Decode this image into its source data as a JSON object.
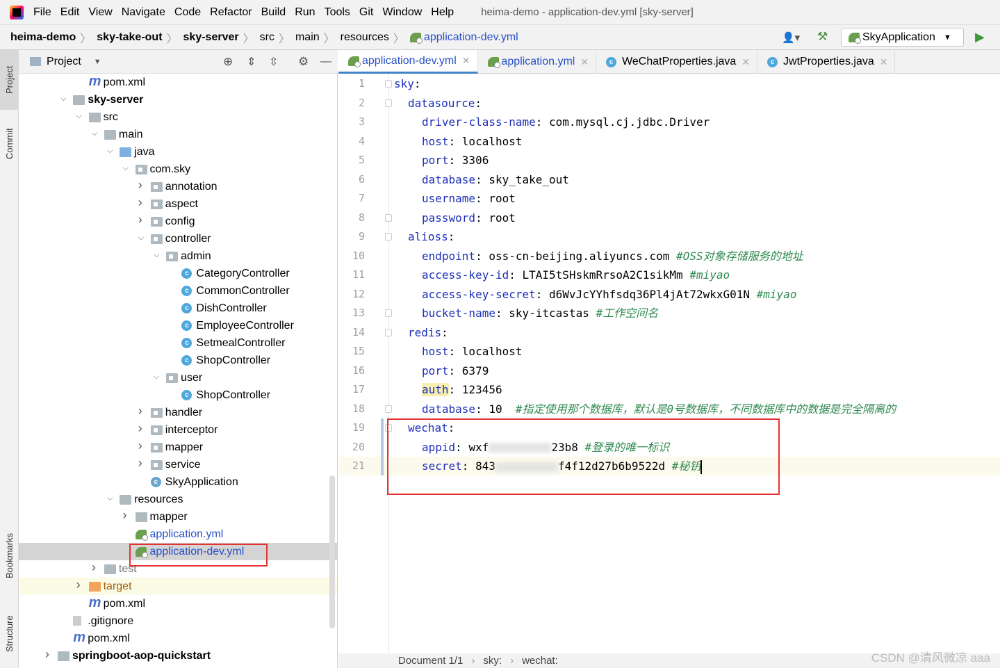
{
  "menu": [
    "File",
    "Edit",
    "View",
    "Navigate",
    "Code",
    "Refactor",
    "Build",
    "Run",
    "Tools",
    "Git",
    "Window",
    "Help"
  ],
  "window_title": "heima-demo - application-dev.yml [sky-server]",
  "breadcrumb": [
    "heima-demo",
    "sky-take-out",
    "sky-server",
    "src",
    "main",
    "resources",
    "application-dev.yml"
  ],
  "run_config": "SkyApplication",
  "left_tabs": [
    "Project",
    "Commit",
    "Bookmarks",
    "Structure"
  ],
  "project_panel": {
    "title": "Project"
  },
  "tree": [
    {
      "label": "pom.xml",
      "depth": 2,
      "icon": "maven",
      "expand": ""
    },
    {
      "label": "sky-server",
      "depth": 1,
      "icon": "module-folder",
      "expand": "open",
      "bold": true
    },
    {
      "label": "src",
      "depth": 2,
      "icon": "folder",
      "expand": "open"
    },
    {
      "label": "main",
      "depth": 3,
      "icon": "folder",
      "expand": "open"
    },
    {
      "label": "java",
      "depth": 4,
      "icon": "source-folder",
      "expand": "open"
    },
    {
      "label": "com.sky",
      "depth": 5,
      "icon": "package",
      "expand": "open"
    },
    {
      "label": "annotation",
      "depth": 6,
      "icon": "package",
      "expand": "closed"
    },
    {
      "label": "aspect",
      "depth": 6,
      "icon": "package",
      "expand": "closed"
    },
    {
      "label": "config",
      "depth": 6,
      "icon": "package",
      "expand": "closed"
    },
    {
      "label": "controller",
      "depth": 6,
      "icon": "package",
      "expand": "open"
    },
    {
      "label": "admin",
      "depth": 7,
      "icon": "package",
      "expand": "open"
    },
    {
      "label": "CategoryController",
      "depth": 8,
      "icon": "class",
      "expand": ""
    },
    {
      "label": "CommonController",
      "depth": 8,
      "icon": "class",
      "expand": ""
    },
    {
      "label": "DishController",
      "depth": 8,
      "icon": "class",
      "expand": ""
    },
    {
      "label": "EmployeeController",
      "depth": 8,
      "icon": "class",
      "expand": ""
    },
    {
      "label": "SetmealController",
      "depth": 8,
      "icon": "class",
      "expand": ""
    },
    {
      "label": "ShopController",
      "depth": 8,
      "icon": "class",
      "expand": ""
    },
    {
      "label": "user",
      "depth": 7,
      "icon": "package",
      "expand": "open"
    },
    {
      "label": "ShopController",
      "depth": 8,
      "icon": "class",
      "expand": ""
    },
    {
      "label": "handler",
      "depth": 6,
      "icon": "package",
      "expand": "closed"
    },
    {
      "label": "interceptor",
      "depth": 6,
      "icon": "package",
      "expand": "closed"
    },
    {
      "label": "mapper",
      "depth": 6,
      "icon": "package",
      "expand": "closed"
    },
    {
      "label": "service",
      "depth": 6,
      "icon": "package",
      "expand": "closed"
    },
    {
      "label": "SkyApplication",
      "depth": 6,
      "icon": "spring-class",
      "expand": ""
    },
    {
      "label": "resources",
      "depth": 4,
      "icon": "resources-folder",
      "expand": "open"
    },
    {
      "label": "mapper",
      "depth": 5,
      "icon": "folder",
      "expand": "closed"
    },
    {
      "label": "application.yml",
      "depth": 5,
      "icon": "yaml",
      "expand": "",
      "color": "blue"
    },
    {
      "label": "application-dev.yml",
      "depth": 5,
      "icon": "yaml",
      "expand": "",
      "color": "blue",
      "selected": true
    },
    {
      "label": "test",
      "depth": 3,
      "icon": "folder",
      "expand": "closed",
      "color": "grey"
    },
    {
      "label": "target",
      "depth": 2,
      "icon": "excluded-folder",
      "expand": "closed",
      "color": "brown",
      "target": true
    },
    {
      "label": "pom.xml",
      "depth": 2,
      "icon": "maven",
      "expand": ""
    },
    {
      "label": ".gitignore",
      "depth": 1,
      "icon": "file",
      "expand": ""
    },
    {
      "label": "pom.xml",
      "depth": 1,
      "icon": "maven",
      "expand": ""
    },
    {
      "label": "springboot-aop-quickstart",
      "depth": 0,
      "icon": "module-folder",
      "expand": "closed",
      "bold": true
    }
  ],
  "tabs": [
    {
      "label": "application-dev.yml",
      "icon": "yaml",
      "active": true
    },
    {
      "label": "application.yml",
      "icon": "yaml"
    },
    {
      "label": "WeChatProperties.java",
      "icon": "class"
    },
    {
      "label": "JwtProperties.java",
      "icon": "class"
    }
  ],
  "code": [
    {
      "indent": 0,
      "key": "sky",
      "val": "",
      "comment": ""
    },
    {
      "indent": 1,
      "key": "datasource",
      "val": "",
      "comment": ""
    },
    {
      "indent": 2,
      "key": "driver-class-name",
      "val": "com.mysql.cj.jdbc.Driver",
      "comment": ""
    },
    {
      "indent": 2,
      "key": "host",
      "val": "localhost",
      "comment": ""
    },
    {
      "indent": 2,
      "key": "port",
      "val": "3306",
      "comment": ""
    },
    {
      "indent": 2,
      "key": "database",
      "val": "sky_take_out",
      "comment": ""
    },
    {
      "indent": 2,
      "key": "username",
      "val": "root",
      "comment": ""
    },
    {
      "indent": 2,
      "key": "password",
      "val": "root",
      "comment": ""
    },
    {
      "indent": 1,
      "key": "alioss",
      "val": "",
      "comment": ""
    },
    {
      "indent": 2,
      "key": "endpoint",
      "val": "oss-cn-beijing.aliyuncs.com",
      "comment": "#OSS对象存储服务的地址"
    },
    {
      "indent": 2,
      "key": "access-key-id",
      "val": "LTAI5tSHskmRrsoA2C1sikMm",
      "comment": "#miyao"
    },
    {
      "indent": 2,
      "key": "access-key-secret",
      "val": "d6WvJcYYhfsdq36Pl4jAt72wkxG01N",
      "comment": "#miyao"
    },
    {
      "indent": 2,
      "key": "bucket-name",
      "val": "sky-itcastas",
      "comment": "#工作空间名"
    },
    {
      "indent": 1,
      "key": "redis",
      "val": "",
      "comment": ""
    },
    {
      "indent": 2,
      "key": "host",
      "val": "localhost",
      "comment": ""
    },
    {
      "indent": 2,
      "key": "port",
      "val": "6379",
      "comment": ""
    },
    {
      "indent": 2,
      "key": "auth",
      "val": "123456",
      "comment": ""
    },
    {
      "indent": 2,
      "key": "database",
      "val": "10 ",
      "comment": "#指定使用那个数据库，默认是0号数据库，不同数据库中的数据是完全隔离的"
    },
    {
      "indent": 1,
      "key": "wechat",
      "val": "",
      "comment": ""
    },
    {
      "indent": 2,
      "key": "appid",
      "val": "wxf",
      "blur": true,
      "val2": "23b8",
      "comment": "#登录的唯一标识"
    },
    {
      "indent": 2,
      "key": "secret",
      "val": "843",
      "blur": true,
      "val2": "f4f12d27b6b9522d",
      "comment": "#秘钥",
      "current": true
    }
  ],
  "status": {
    "doc": "Document 1/1",
    "path": [
      "sky:",
      "wechat:"
    ]
  },
  "watermark": "CSDN @清风微凉 aaa"
}
